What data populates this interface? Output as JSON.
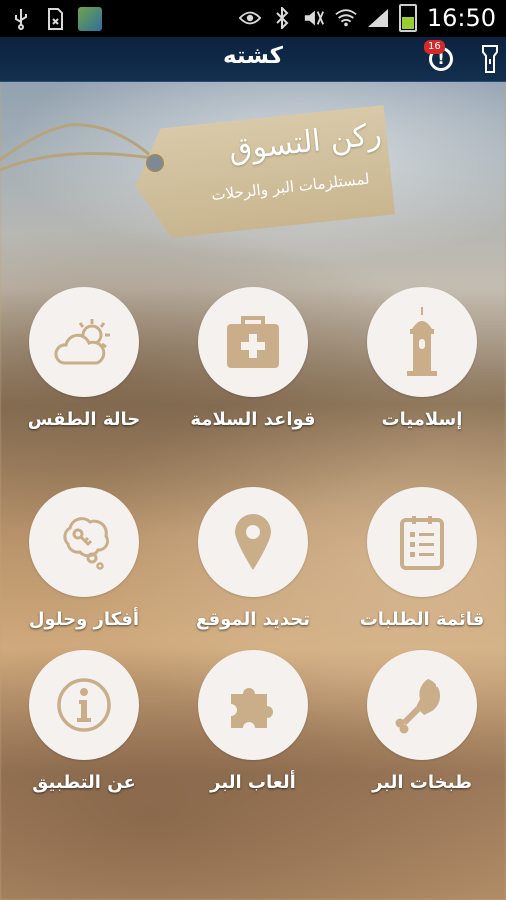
{
  "statusbar": {
    "time": "16:50",
    "icons": [
      "usb-icon",
      "sim-icon",
      "app-thumbnail",
      "eye-icon",
      "bluetooth-icon",
      "mute-icon",
      "wifi-icon",
      "signal-icon",
      "battery-icon"
    ]
  },
  "appbar": {
    "title": "كشته",
    "notification_count": "16",
    "notification_symbol": "!"
  },
  "banner": {
    "title": "ركن التسوق",
    "subtitle": "لمستلزمات البر والرحلات"
  },
  "grid": {
    "items": [
      {
        "label": "إسلاميات",
        "icon": "mosque-minaret-icon"
      },
      {
        "label": "قواعد السلامة",
        "icon": "first-aid-kit-icon"
      },
      {
        "label": "حالة الطقس",
        "icon": "weather-cloud-sun-icon"
      },
      {
        "label": "قائمة الطلبات",
        "icon": "checklist-icon"
      },
      {
        "label": "تحديد الموقع",
        "icon": "location-pin-icon"
      },
      {
        "label": "أفكار وحلول",
        "icon": "idea-thought-bubble-icon"
      },
      {
        "label": "طبخات البر",
        "icon": "chicken-leg-icon"
      },
      {
        "label": "ألعاب البر",
        "icon": "puzzle-icon"
      },
      {
        "label": "عن التطبيق",
        "icon": "info-icon"
      }
    ]
  },
  "colors": {
    "appbar": "#0b223e",
    "icon": "#c9ae89",
    "circle": "#f4f1ee",
    "badge": "#d62a2a"
  }
}
